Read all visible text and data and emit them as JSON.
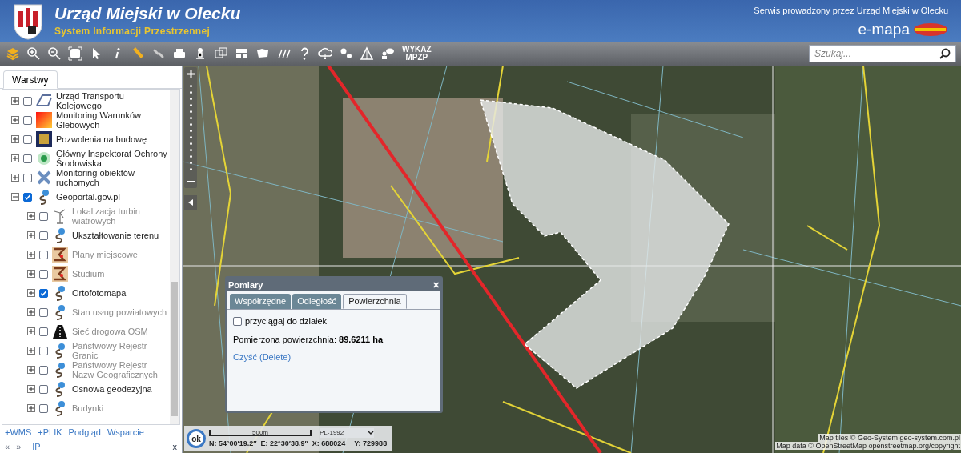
{
  "header": {
    "title": "Urząd Miejski w Olecku",
    "subtitle": "System Informacji Przestrzennej",
    "service_note": "Serwis prowadzony przez Urząd Miejski w Olecku",
    "brand": "e-mapa"
  },
  "toolbar": {
    "wykaz_label": [
      "WYKAZ",
      "MPZP"
    ],
    "search": {
      "placeholder": "Szukaj..."
    }
  },
  "sidebar": {
    "tabs": [
      {
        "label": "Warstwy",
        "selected": true
      }
    ],
    "layers": [
      {
        "label": "Urząd Transportu Kolejowego",
        "kind": "rail",
        "checked": false,
        "expanded": false,
        "disabled": false
      },
      {
        "label": "Monitoring Warunków Glebowych",
        "kind": "gradient",
        "checked": false,
        "expanded": false,
        "disabled": false
      },
      {
        "label": "Pozwolenia na budowę",
        "kind": "badge",
        "checked": false,
        "expanded": false,
        "disabled": false
      },
      {
        "label": "Główny Inspektorat Ochrony Środowiska",
        "kind": "leaf",
        "checked": false,
        "expanded": false,
        "disabled": false
      },
      {
        "label": "Monitoring obiektów ruchomych",
        "kind": "satellite",
        "checked": false,
        "expanded": false,
        "disabled": false
      },
      {
        "label": "Geoportal.gov.pl",
        "kind": "globe",
        "checked": true,
        "expanded": true,
        "disabled": false,
        "children": [
          {
            "label": "Lokalizacja turbin wiatrowych",
            "kind": "turbine",
            "checked": false,
            "expanded": false,
            "disabled": true
          },
          {
            "label": "Ukształtowanie terenu",
            "kind": "globe",
            "checked": false,
            "expanded": false,
            "disabled": false
          },
          {
            "label": "Plany miejscowe",
            "kind": "plan",
            "checked": false,
            "expanded": false,
            "disabled": true
          },
          {
            "label": "Studium",
            "kind": "plan",
            "checked": false,
            "expanded": false,
            "disabled": true
          },
          {
            "label": "Ortofotomapa",
            "kind": "globe",
            "checked": true,
            "expanded": false,
            "disabled": false
          },
          {
            "label": "Stan usług powiatowych",
            "kind": "globe",
            "checked": false,
            "expanded": false,
            "disabled": true
          },
          {
            "label": "Sieć drogowa OSM",
            "kind": "road",
            "checked": false,
            "expanded": false,
            "disabled": true
          },
          {
            "label": "Państwowy Rejestr Granic",
            "kind": "globe",
            "checked": false,
            "expanded": false,
            "disabled": true
          },
          {
            "label": "Państwowy Rejestr Nazw Geograficznych",
            "kind": "globe",
            "checked": false,
            "expanded": false,
            "disabled": true
          },
          {
            "label": "Osnowa geodezyjna",
            "kind": "globe",
            "checked": false,
            "expanded": false,
            "disabled": false
          },
          {
            "label": "Budynki",
            "kind": "globe",
            "checked": false,
            "expanded": false,
            "disabled": true
          }
        ]
      }
    ],
    "links": [
      "+WMS",
      "+PLIK",
      "Podgląd",
      "Wsparcie"
    ],
    "footer": {
      "prev": "«",
      "next": "»",
      "ip": "IP",
      "close": "x"
    }
  },
  "dialog": {
    "title": "Pomiary",
    "close": "✕",
    "tabs": [
      {
        "label": "Współrzędne",
        "selected": false
      },
      {
        "label": "Odległość",
        "selected": false
      },
      {
        "label": "Powierzchnia",
        "selected": true
      }
    ],
    "snap": {
      "label": "przyciągaj do działek",
      "checked": false
    },
    "result": "Pomierzona powierzchnia: **89.6211 ha**",
    "clear_link": "Czyść (Delete)"
  },
  "status_bar": {
    "ok": "ok",
    "scale": "500m",
    "projection": "PL-1992",
    "n": "N: 54°00′19.2″",
    "e": "E: 22°30′38.9″",
    "x": "X: 688024",
    "y": "Y: 729988"
  },
  "attribution": [
    "Map tiles © Geo-System geo-system.com.pl",
    "Map data © OpenStreetMap openstreetmap.org/copyright"
  ]
}
